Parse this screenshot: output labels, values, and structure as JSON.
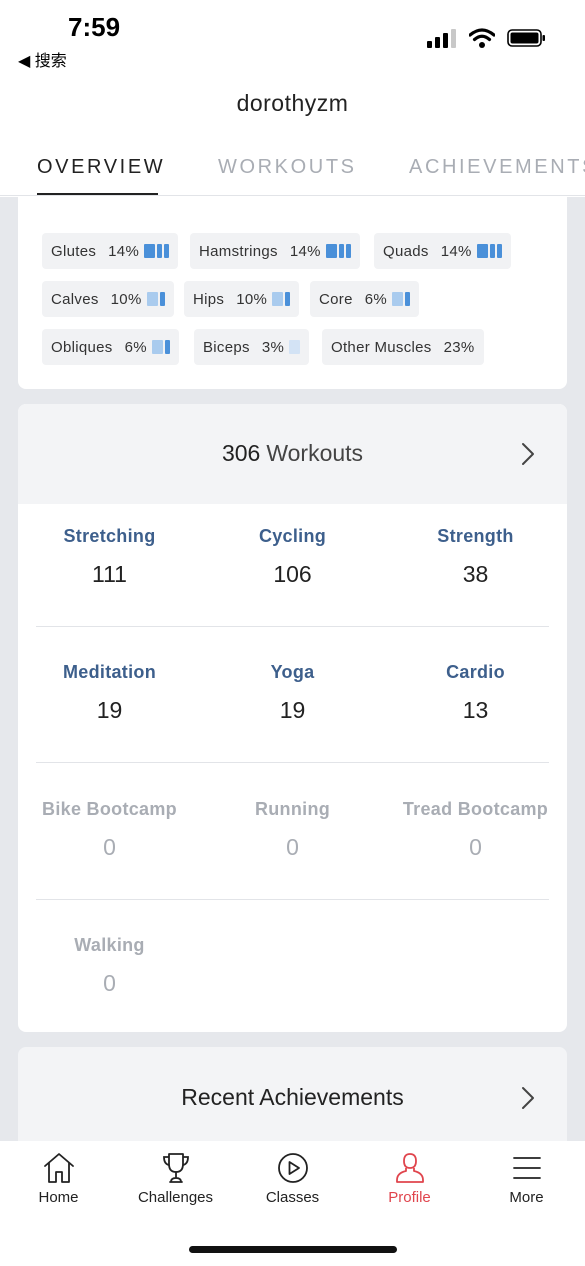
{
  "status_bar": {
    "time": "7:59",
    "back_label": "◀ 搜索"
  },
  "profile": {
    "username": "dorothyzm"
  },
  "tabs": [
    {
      "label": "OVERVIEW",
      "active": true
    },
    {
      "label": "WORKOUTS",
      "active": false
    },
    {
      "label": "ACHIEVEMENTS",
      "active": false
    }
  ],
  "muscles": [
    {
      "name": "Glutes",
      "percent": "14%",
      "level": 3
    },
    {
      "name": "Hamstrings",
      "percent": "14%",
      "level": 3
    },
    {
      "name": "Quads",
      "percent": "14%",
      "level": 3
    },
    {
      "name": "Calves",
      "percent": "10%",
      "level": 2
    },
    {
      "name": "Hips",
      "percent": "10%",
      "level": 2
    },
    {
      "name": "Core",
      "percent": "6%",
      "level": 2
    },
    {
      "name": "Obliques",
      "percent": "6%",
      "level": 2
    },
    {
      "name": "Biceps",
      "percent": "3%",
      "level": 1
    },
    {
      "name": "Other Muscles",
      "percent": "23%",
      "level": 0
    }
  ],
  "workouts": {
    "count": "306",
    "label": "Workouts",
    "disciplines": [
      {
        "name": "Stretching",
        "count": "111"
      },
      {
        "name": "Cycling",
        "count": "106"
      },
      {
        "name": "Strength",
        "count": "38"
      },
      {
        "name": "Meditation",
        "count": "19"
      },
      {
        "name": "Yoga",
        "count": "19"
      },
      {
        "name": "Cardio",
        "count": "13"
      },
      {
        "name": "Bike Bootcamp",
        "count": "0"
      },
      {
        "name": "Running",
        "count": "0"
      },
      {
        "name": "Tread Bootcamp",
        "count": "0"
      },
      {
        "name": "Walking",
        "count": "0"
      }
    ]
  },
  "recent_achievements": {
    "title": "Recent Achievements"
  },
  "bottom_nav": [
    {
      "label": "Home",
      "icon": "home-icon",
      "active": false
    },
    {
      "label": "Challenges",
      "icon": "trophy-icon",
      "active": false
    },
    {
      "label": "Classes",
      "icon": "play-circle-icon",
      "active": false
    },
    {
      "label": "Profile",
      "icon": "profile-icon",
      "active": true
    },
    {
      "label": "More",
      "icon": "hamburger-menu-icon",
      "active": false
    }
  ],
  "colors": {
    "accent": "#e0454d",
    "discipline_blue": "#3d5f8c",
    "bar_dark": "#4a90d9",
    "bar_light": "#a9cbee",
    "bar_pale": "#d3e3f5",
    "background_gray": "#e6e8ec"
  }
}
